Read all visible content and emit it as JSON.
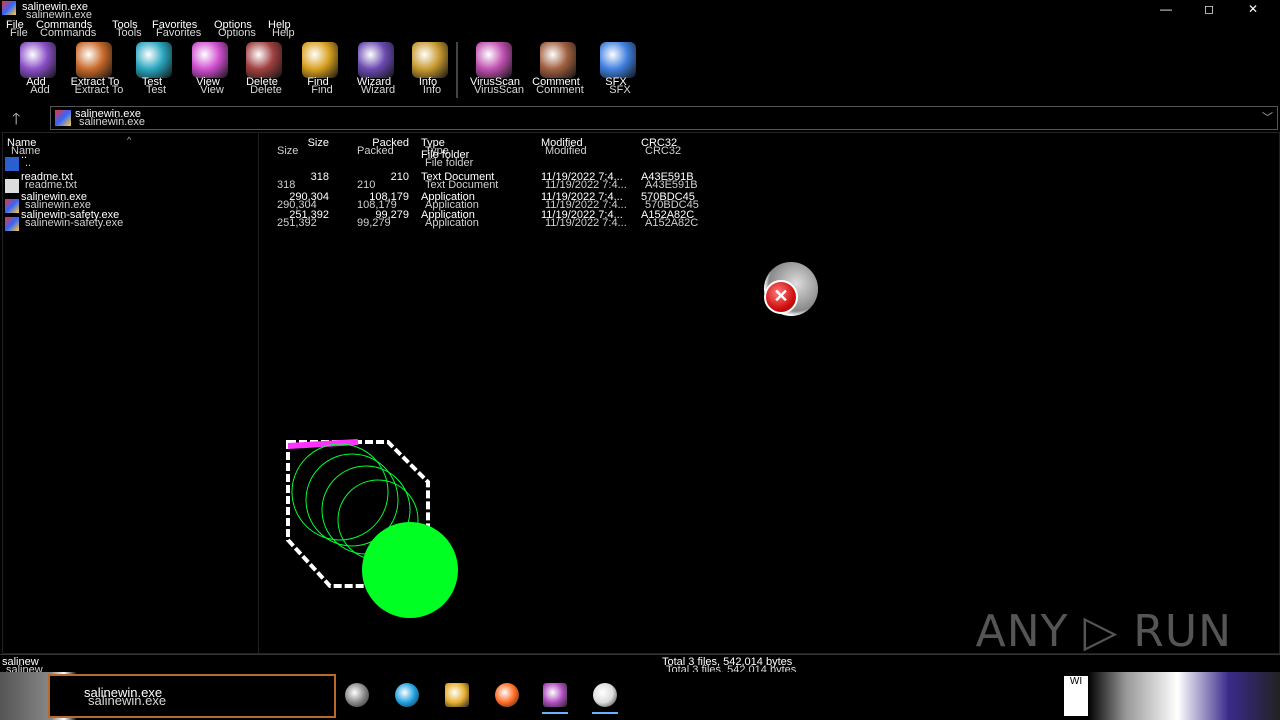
{
  "window": {
    "title": "salinewin.exe",
    "controls": {
      "minimize": "—",
      "maximize": "◻",
      "close": "✕"
    }
  },
  "menu": [
    "File",
    "Commands",
    "Tools",
    "Favorites",
    "Options",
    "Help"
  ],
  "toolbar": [
    {
      "label": "Add",
      "icon": "add-icon",
      "color": "#8a4fc7"
    },
    {
      "label": "Extract To",
      "icon": "extract-icon",
      "color": "#c86a2a"
    },
    {
      "label": "Test",
      "icon": "test-icon",
      "color": "#2aa6c0"
    },
    {
      "label": "View",
      "icon": "view-icon",
      "color": "#d04fd0"
    },
    {
      "label": "Delete",
      "icon": "delete-icon",
      "color": "#a04040"
    },
    {
      "label": "Find",
      "icon": "find-icon",
      "color": "#d8a020"
    },
    {
      "label": "Wizard",
      "icon": "wizard-icon",
      "color": "#6a4ab0"
    },
    {
      "label": "Info",
      "icon": "info-icon",
      "color": "#c89a30"
    },
    {
      "label": "VirusScan",
      "icon": "virusscan-icon",
      "color": "#c050b0"
    },
    {
      "label": "Comment",
      "icon": "comment-icon",
      "color": "#a06040"
    },
    {
      "label": "SFX",
      "icon": "sfx-icon",
      "color": "#4080e0"
    }
  ],
  "address": {
    "path": "salinewin.exe"
  },
  "columns": {
    "name": "Name",
    "size": "Size",
    "packed": "Packed",
    "type": "Type",
    "modified": "Modified",
    "crc": "CRC32"
  },
  "files": [
    {
      "name": "..",
      "size": "",
      "packed": "",
      "type": "File folder",
      "modified": "",
      "crc": "",
      "icon": "folder-icon"
    },
    {
      "name": "readme.txt",
      "size": "318",
      "packed": "210",
      "type": "Text Document",
      "modified": "11/19/2022 7:4...",
      "crc": "A43E591B",
      "icon": "text-file-icon"
    },
    {
      "name": "salinewin.exe",
      "size": "290,304",
      "packed": "108,179",
      "type": "Application",
      "modified": "11/19/2022 7:4...",
      "crc": "570BDC45",
      "icon": "exe-file-icon"
    },
    {
      "name": "salinewin-safety.exe",
      "size": "251,392",
      "packed": "99,279",
      "type": "Application",
      "modified": "11/19/2022 7:4...",
      "crc": "A152A82C",
      "icon": "exe-file-icon"
    }
  ],
  "status": {
    "left": "salinew",
    "right": "Total 3 files, 542,014 bytes"
  },
  "taskbar": {
    "active_window": "salinewin.exe",
    "apps": [
      {
        "name": "task-view",
        "color": "#888888"
      },
      {
        "name": "edge",
        "color": "#1fa0e0"
      },
      {
        "name": "file-explorer",
        "color": "#e8b030"
      },
      {
        "name": "firefox",
        "color": "#ff6a20"
      },
      {
        "name": "winrar",
        "color": "#b04fc0"
      },
      {
        "name": "settings",
        "color": "#dddddd"
      }
    ],
    "tray": "WI"
  },
  "watermark": "ANY ▷ RUN"
}
